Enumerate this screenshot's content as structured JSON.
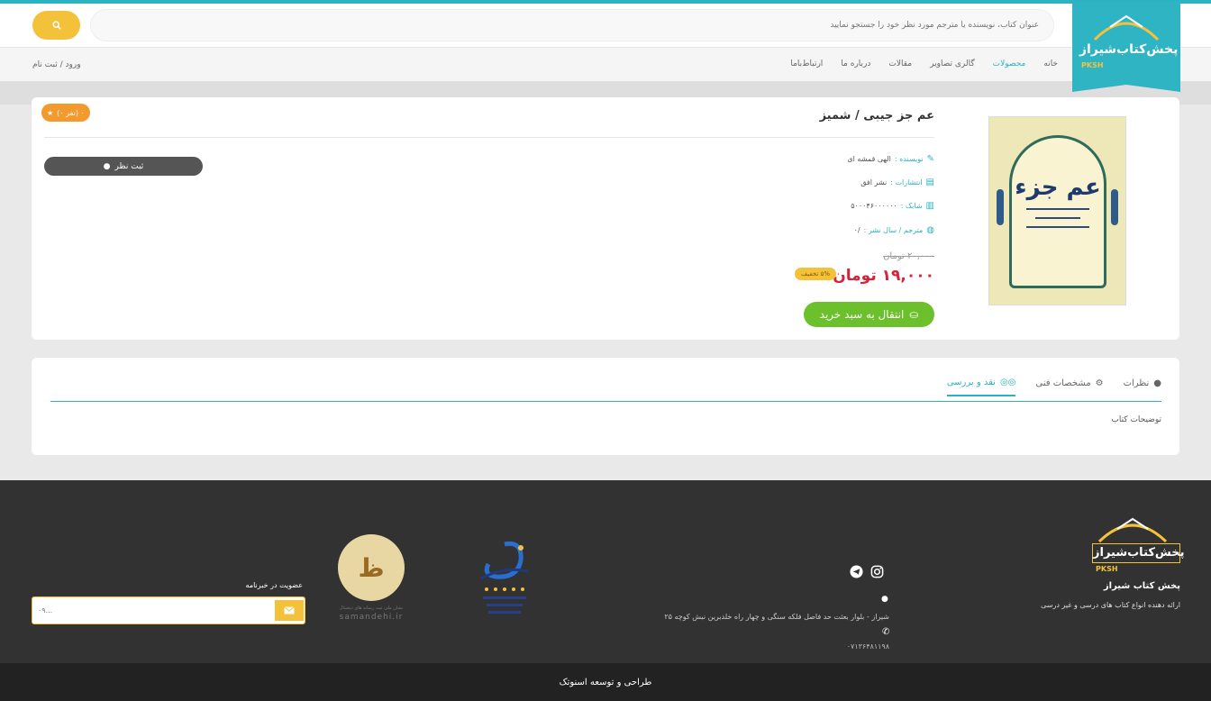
{
  "header": {
    "search_placeholder": "عنوان کتاب، نویسنده یا مترجم مورد نظر خود را جستجو نمایید",
    "logo_text": "پخش‌کتاب‌شیراز",
    "logo_sub": "PKSH",
    "login": "ورود / ثبت نام"
  },
  "nav": [
    "خانه",
    "محصولات",
    "گالری تصاویر",
    "مقالات",
    "درباره ما",
    "ارتباط‌باما"
  ],
  "nav_active": "محصولات",
  "product": {
    "title": "عم جز جیبی / شمیز",
    "rating": "(۰ نفر) ۰",
    "comment_button": "ثبت نظر",
    "author_label": "نویسنده :",
    "author": "الهی قمشه ای",
    "publisher_label": "انتشارات :",
    "publisher": "نشر افق",
    "isbn_label": "شابک :",
    "isbn": "۵۰۰۰۴۶۰۰۰۰۰۰",
    "translator_label": "مترجم / سال نشر :",
    "translator": "/۰",
    "old_price": "۲۰,۰۰۰ تومان",
    "new_price": "۱۹,۰۰۰ تومان",
    "discount": "۵% تخفیف",
    "cart_button": "انتقال به سبد خرید",
    "cover_title": "عم جزء"
  },
  "tabs": {
    "items": [
      "نقد و بررسی",
      "مشخصات فنی",
      "نظرات"
    ],
    "active": "نقد و بررسی",
    "content": "توضیحات کتاب"
  },
  "footer": {
    "logo_text": "پخش‌کتاب‌شیراز",
    "logo_sub": "PKSH",
    "name": "پخش کتاب شیراز",
    "desc": "ارائه دهنده انواع کتاب های درسی و غیر درسی",
    "address": "شیراز - بلوار بعثت حد فاصل فلکه سنگی و چهار راه خلدبرین نبش کوچه ۲۵",
    "phone": "۰۷۱۳۶۴۸۱۱۹۸",
    "samandehi_small": "نشان ملی ثبت رسانه های دیجیتال",
    "samandehi_url": "samandehi.ir",
    "newsletter_title": "عضویت در خبرنامه",
    "newsletter_placeholder": "۰۹..."
  },
  "bottom_bar": "طراحی و توسعه اسنوتک",
  "colors": {
    "accent": "#2cb3c2",
    "yellow": "#f4c23a",
    "green": "#6cc02b",
    "price": "#d5243a",
    "footer": "#323232"
  }
}
